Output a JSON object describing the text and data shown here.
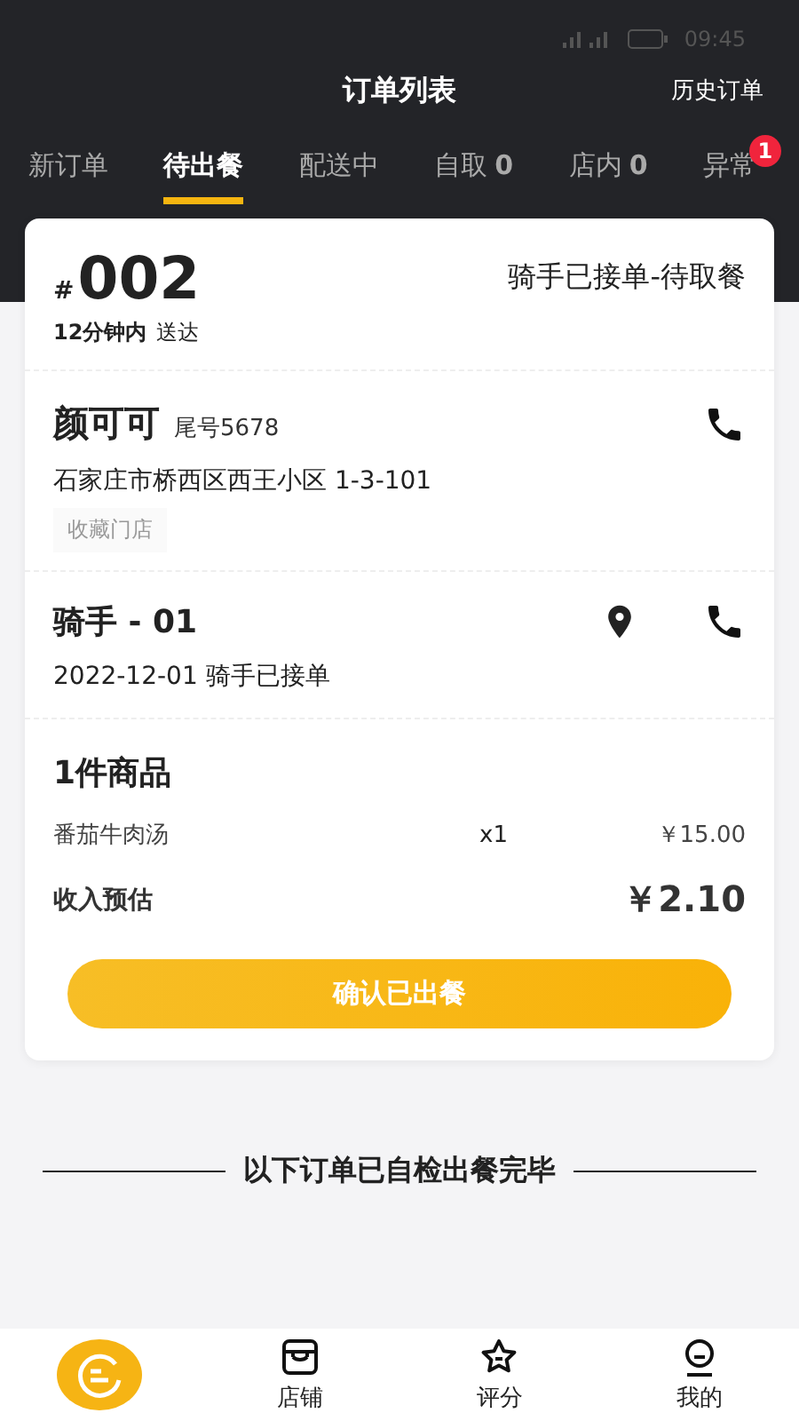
{
  "status_bar": {
    "time": "09:45"
  },
  "header": {
    "title": "订单列表",
    "action": "历史订单"
  },
  "tabs": [
    {
      "label": "新订单",
      "selected": false
    },
    {
      "label": "待出餐",
      "selected": true
    },
    {
      "label": "配送中",
      "selected": false
    },
    {
      "label": "自取",
      "count": "0",
      "selected": false
    },
    {
      "label": "店内",
      "count": "0",
      "selected": false
    },
    {
      "label": "异常",
      "badge": "1",
      "selected": false
    }
  ],
  "order": {
    "hash": "#",
    "number": "002",
    "eta": "12分钟内",
    "eta_suffix": "送达",
    "status": "骑手已接单-待取餐",
    "customer": {
      "name": "颜可可",
      "tail": "尾号5678",
      "address": "石家庄市桥西区西王小区 1-3-101",
      "tag": "收藏门店"
    },
    "rider": {
      "name": "骑手 - 01",
      "info": "2022-12-01 骑手已接单"
    },
    "goods": {
      "title": "1件商品",
      "items": [
        {
          "name": "番茄牛肉汤",
          "qty": "x1",
          "price": "￥15.00"
        }
      ],
      "income_label": "收入预估",
      "income": "￥2.10"
    },
    "confirm": "确认已出餐"
  },
  "divider_text": "以下订单已自检出餐完毕",
  "nav": [
    {
      "kind": "logo",
      "selected": true
    },
    {
      "kind": "shop",
      "label": "店铺",
      "selected": false
    },
    {
      "kind": "star",
      "label": "评分",
      "selected": false
    },
    {
      "kind": "me",
      "label": "我的",
      "selected": false
    }
  ]
}
